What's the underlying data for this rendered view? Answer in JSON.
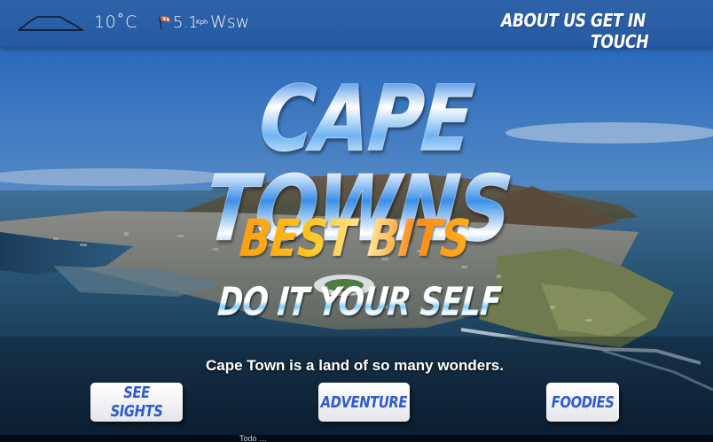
{
  "header": {
    "temperature": "10˚C",
    "wind_speed": "5.1",
    "wind_unit": "Kph",
    "wind_direction": "Wsw",
    "nav": [
      {
        "label": "ABOUT US"
      },
      {
        "label": "GET IN TOUCH"
      }
    ]
  },
  "hero": {
    "title": "CAPE TOWNS",
    "subtitle": "BEST BITS",
    "tagline": "DO IT YOUR SELF",
    "description": "Cape Town is a land of so many wonders."
  },
  "buttons": [
    {
      "label": "SEE SIGHTS"
    },
    {
      "label": "ADVENTURE"
    },
    {
      "label": "FOODIES"
    }
  ],
  "footer_peek": "Todo …",
  "icons": [
    "table-mountain-icon",
    "wind-icon"
  ],
  "colors": {
    "header": "#2f63a8",
    "button_text": "#2f5bcf",
    "subtitle_orange": "#ff9a10",
    "title_blue": "#2a7fe0"
  }
}
